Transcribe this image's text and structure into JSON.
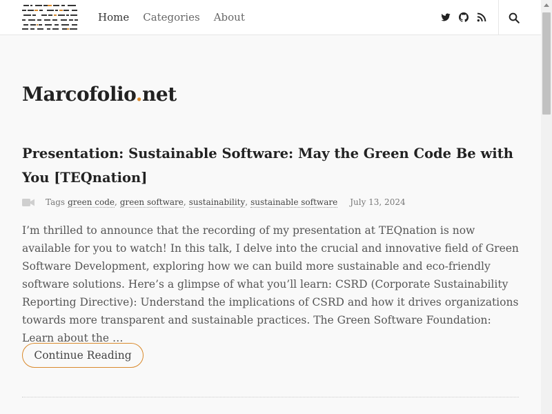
{
  "header": {
    "nav": [
      {
        "label": "Home"
      },
      {
        "label": "Categories"
      },
      {
        "label": "About"
      }
    ],
    "social_icons": [
      "twitter-icon",
      "github-icon",
      "rss-icon"
    ],
    "search_icon": "search-icon"
  },
  "site": {
    "title_main": "Marcofolio",
    "title_dot": ".",
    "title_tld": "net"
  },
  "post": {
    "title": "Presentation: Sustainable Software: May the Green Code Be with You [TEQnation]",
    "format_icon": "video-icon",
    "tags_label": "Tags",
    "tags": [
      "green code",
      "green software",
      "sustainability",
      "sustainable software"
    ],
    "date": "July 13, 2024",
    "excerpt": "I’m thrilled to announce that the recording of my presentation at TEQnation is now available for you to watch! In this talk, I delve into the crucial and innovative field of Green Software Development, exploring how we can build more sustainable and eco-friendly software solutions. Here’s a glimpse of what you’ll learn: CSRD (Corporate Sustainability Reporting Directive): Understand the implications of CSRD and how it drives organizations towards more transparent and sustainable practices. The Green Software Foundation: Learn about the …",
    "continue_label": "Continue Reading"
  },
  "colors": {
    "accent": "#d9892b",
    "text_dark": "#222222",
    "background": "#f9f9f9"
  }
}
